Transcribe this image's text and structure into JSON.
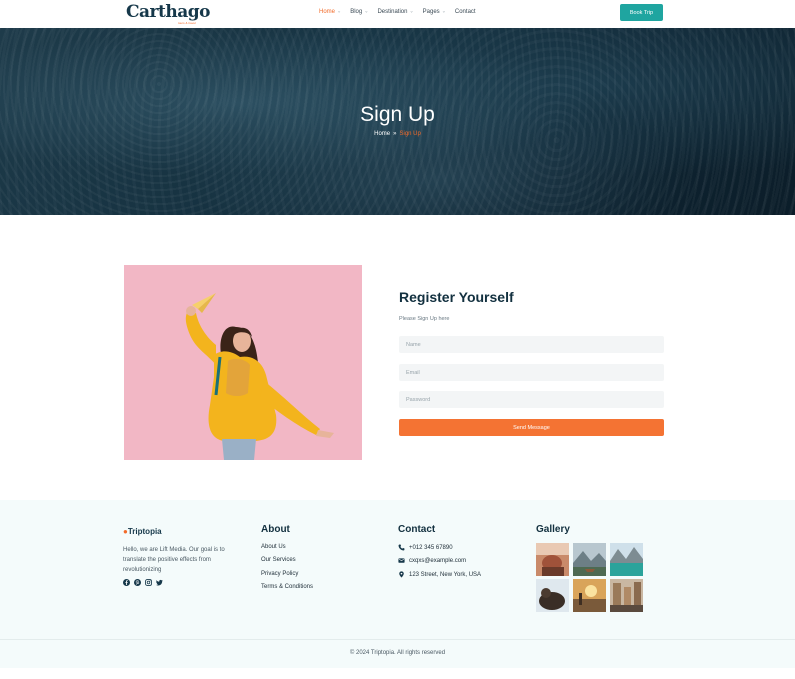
{
  "header": {
    "logo_text": "Carthago",
    "logo_sub": "tours & travel",
    "nav": [
      {
        "label": "Home",
        "has_dropdown": true,
        "active": true
      },
      {
        "label": "Blog",
        "has_dropdown": true,
        "active": false
      },
      {
        "label": "Destination",
        "has_dropdown": true,
        "active": false
      },
      {
        "label": "Pages",
        "has_dropdown": true,
        "active": false
      },
      {
        "label": "Contact",
        "has_dropdown": false,
        "active": false
      }
    ],
    "book_button": "Book Trip"
  },
  "hero": {
    "title": "Sign Up",
    "breadcrumb_home": "Home",
    "breadcrumb_sep": "»",
    "breadcrumb_current": "Sign Up"
  },
  "register": {
    "title": "Register Yourself",
    "subtitle": "Please Sign Up here",
    "name_placeholder": "Name",
    "email_placeholder": "Email",
    "password_placeholder": "Password",
    "submit_label": "Send Message"
  },
  "footer": {
    "logo": "Triptopia",
    "about_text": "Hello, we are Lift Media. Our goal is to translate the positive effects from revolutionizing",
    "socials": [
      "facebook-icon",
      "pinterest-icon",
      "instagram-icon",
      "twitter-icon"
    ],
    "about_title": "About",
    "about_links": [
      "About Us",
      "Our Services",
      "Privacy Policy",
      "Terms & Conditions"
    ],
    "contact_title": "Contact",
    "phone": "+012 345 67890",
    "email": "cxqxs@example.com",
    "address": "123 Street, New York, USA",
    "gallery_title": "Gallery",
    "copyright": "© 2024 Triptopia. All rights reserved"
  },
  "colors": {
    "accent": "#f47333",
    "teal": "#1fa5a0",
    "navy": "#12303f"
  }
}
